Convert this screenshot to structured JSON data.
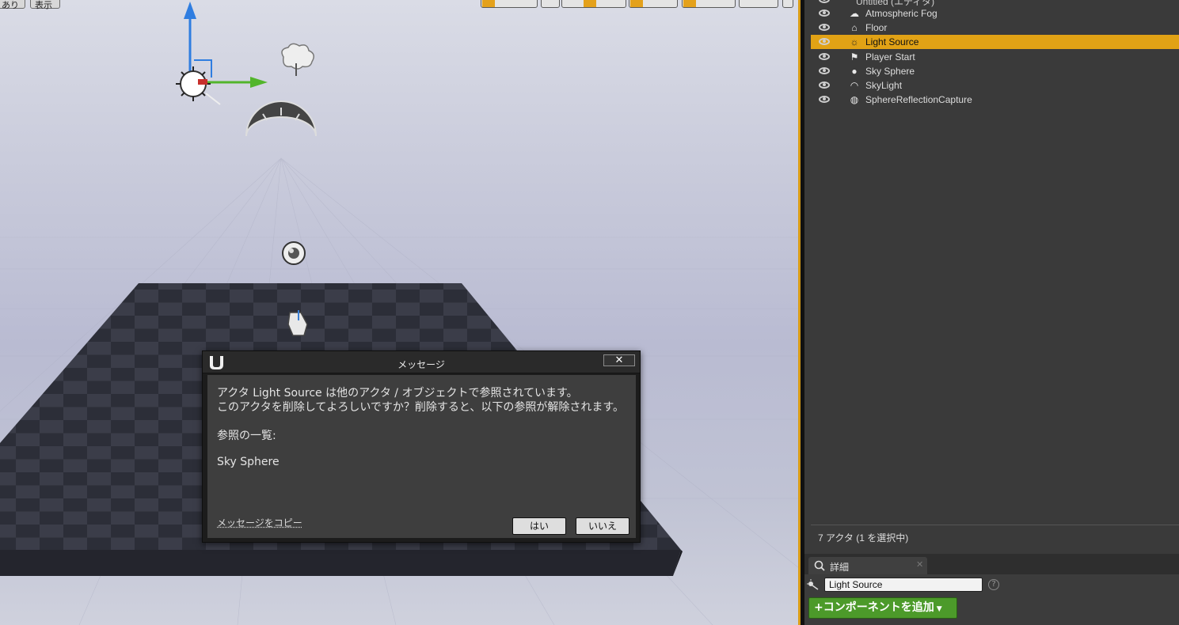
{
  "viewport": {
    "menu_left": "あり",
    "menu_show": "表示"
  },
  "outliner": {
    "header_item": "Untitled (エディタ)",
    "items": [
      {
        "label": "Atmospheric Fog",
        "icon": "fog-icon"
      },
      {
        "label": "Floor",
        "icon": "static-mesh-icon"
      },
      {
        "label": "Light Source",
        "icon": "directional-light-icon",
        "selected": true
      },
      {
        "label": "Player Start",
        "icon": "player-start-icon"
      },
      {
        "label": "Sky Sphere",
        "icon": "sphere-icon"
      },
      {
        "label": "SkyLight",
        "icon": "sky-light-icon"
      },
      {
        "label": "SphereReflectionCapture",
        "icon": "reflection-capture-icon"
      }
    ],
    "actor_count": "7 アクタ (1 を選択中)"
  },
  "details": {
    "tab_label": "詳細",
    "name_value": "Light Source",
    "add_component_label": "コンポーネントを追加"
  },
  "dialog": {
    "title": "メッセージ",
    "close_symbol": "✕",
    "line1": "アクタ Light Source は他のアクタ / オブジェクトで参照されています。",
    "line2": "このアクタを削除してよろしいですか？削除すると、以下の参照が解除されます。",
    "line3": "参照の一覧:",
    "line4": "Sky Sphere",
    "copy_link": "メッセージをコピー",
    "yes": "はい",
    "no": "いいえ"
  },
  "colors": {
    "selection": "#e1a215",
    "add_button": "#4c9a2a",
    "dialog_bg": "#3e3e3e"
  }
}
